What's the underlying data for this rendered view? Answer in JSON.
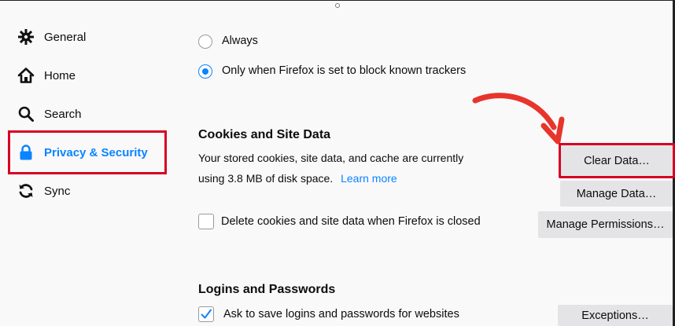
{
  "sidebar": {
    "items": [
      {
        "label": "General",
        "icon": "gear-icon"
      },
      {
        "label": "Home",
        "icon": "home-icon"
      },
      {
        "label": "Search",
        "icon": "search-icon"
      },
      {
        "label": "Privacy & Security",
        "icon": "lock-icon",
        "active": true
      },
      {
        "label": "Sync",
        "icon": "sync-icon"
      }
    ],
    "highlight_color": "#d70022"
  },
  "tracking": {
    "option_always": "Always",
    "option_known": "Only when Firefox is set to block known trackers",
    "selected": "option_known"
  },
  "cookies": {
    "heading": "Cookies and Site Data",
    "description_line1": "Your stored cookies, site data, and cache are currently",
    "description_line2": "using 3.8 MB of disk space.",
    "learn_more": "Learn more",
    "clear_data_button": "Clear Data…",
    "manage_data_button": "Manage Data…",
    "delete_on_close_label": "Delete cookies and site data when Firefox is closed",
    "delete_on_close_checked": false,
    "manage_permissions_button": "Manage Permissions…"
  },
  "logins": {
    "heading": "Logins and Passwords",
    "ask_to_save_label": "Ask to save logins and passwords for websites",
    "ask_to_save_checked": true,
    "exceptions_button": "Exceptions…"
  },
  "colors": {
    "accent": "#0a84ff",
    "annotation_red": "#d70022",
    "arrow_red": "#e8352c"
  }
}
